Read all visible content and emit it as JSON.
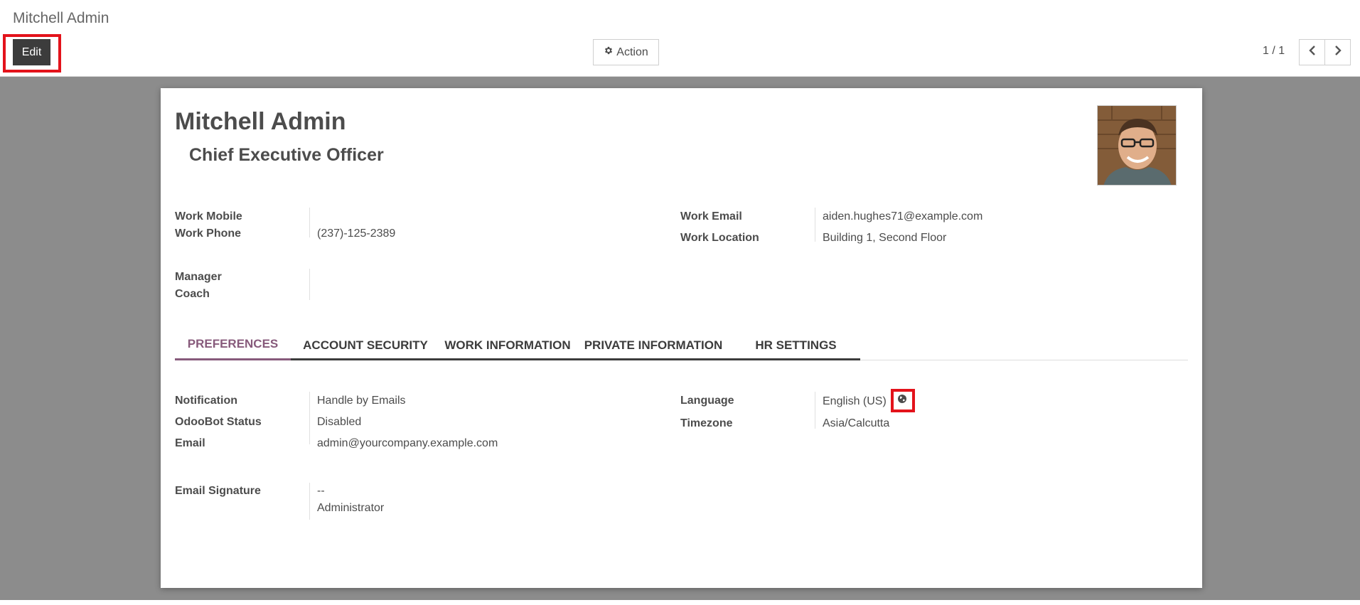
{
  "breadcrumb": "Mitchell Admin",
  "toolbar": {
    "edit_label": "Edit",
    "action_label": "Action",
    "pager_value": "1 / 1"
  },
  "employee": {
    "name": "Mitchell Admin",
    "job_title": "Chief Executive Officer"
  },
  "contact": {
    "work_mobile_label": "Work Mobile",
    "work_mobile_value": "",
    "work_phone_label": "Work Phone",
    "work_phone_value": "(237)-125-2389",
    "work_email_label": "Work Email",
    "work_email_value": "aiden.hughes71@example.com",
    "work_location_label": "Work Location",
    "work_location_value": "Building 1, Second Floor",
    "manager_label": "Manager",
    "manager_value": "",
    "coach_label": "Coach",
    "coach_value": ""
  },
  "tabs": [
    {
      "label": "PREFERENCES",
      "active": true
    },
    {
      "label": "ACCOUNT SECURITY",
      "active": false
    },
    {
      "label": "WORK INFORMATION",
      "active": false
    },
    {
      "label": "PRIVATE INFORMATION",
      "active": false
    },
    {
      "label": "HR SETTINGS",
      "active": false
    }
  ],
  "preferences": {
    "notification_label": "Notification",
    "notification_value": "Handle by Emails",
    "odoobot_label": "OdooBot Status",
    "odoobot_value": "Disabled",
    "email_label": "Email",
    "email_value": "admin@yourcompany.example.com",
    "signature_label": "Email Signature",
    "signature_line1": "--",
    "signature_line2": "Administrator",
    "language_label": "Language",
    "language_value": "English (US)",
    "timezone_label": "Timezone",
    "timezone_value": "Asia/Calcutta"
  },
  "icons": {
    "action": "gear-icon",
    "prev": "chevron-left-icon",
    "next": "chevron-right-icon",
    "language": "globe-icon"
  },
  "colors": {
    "accent": "#875a7b",
    "highlight": "#e3131b",
    "button_dark": "#3c3c3c",
    "background": "#8c8c8c"
  }
}
